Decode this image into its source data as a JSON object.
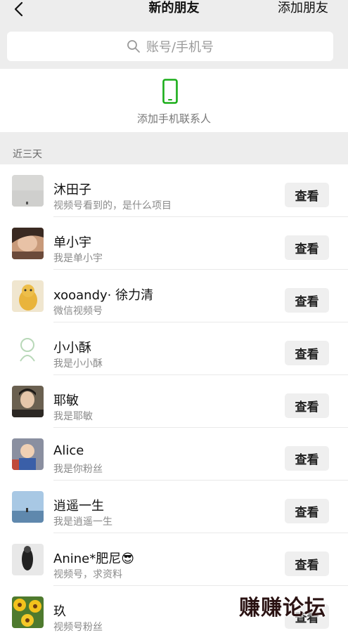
{
  "nav": {
    "title": "新的朋友",
    "add_friends_label": "添加朋友"
  },
  "search": {
    "placeholder": "账号/手机号"
  },
  "phone_contacts": {
    "label": "添加手机联系人"
  },
  "section": {
    "label": "近三天"
  },
  "view_label": "查看",
  "contacts": [
    {
      "name": "沐田子",
      "message": "视频号看到的，是什么项目"
    },
    {
      "name": "单小宇",
      "message": "我是单小宇"
    },
    {
      "name": "xooandy· 徐力清",
      "message": "微信视频号"
    },
    {
      "name": "小小酥",
      "message": "我是小小酥"
    },
    {
      "name": "耶敏",
      "message": "我是耶敏"
    },
    {
      "name": "Alice",
      "message": "我是你粉丝"
    },
    {
      "name": "逍遥一生",
      "message": "我是逍遥一生"
    },
    {
      "name": "Anine*肥尼😎",
      "message": "视频号，求资料"
    },
    {
      "name": "玖",
      "message": "视频号粉丝"
    }
  ],
  "watermark": "赚赚论坛",
  "colors": {
    "accent_green": "#1aad19",
    "background": "#ededed"
  }
}
